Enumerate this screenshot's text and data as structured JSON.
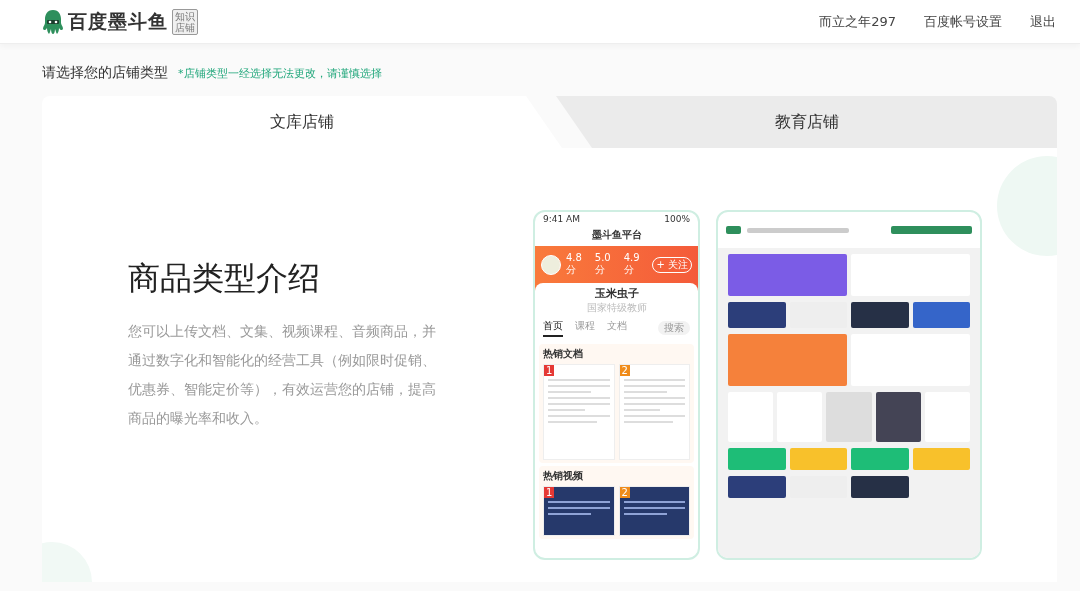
{
  "header": {
    "logo": {
      "name": "百度墨斗鱼",
      "badge": [
        "知识",
        "店铺"
      ]
    },
    "links": [
      "而立之年297",
      "百度帐号设置",
      "退出"
    ]
  },
  "prompt": {
    "title": "请选择您的店铺类型",
    "note": "*店铺类型一经选择无法更改，请谨慎选择"
  },
  "tabs": [
    {
      "label": "文库店铺",
      "selected": true
    },
    {
      "label": "教育店铺",
      "selected": false
    }
  ],
  "intro": {
    "heading": "商品类型介绍",
    "body": "您可以上传文档、文集、视频课程、音频商品，并通过数字化和智能化的经营工具（例如限时促销、优惠券、智能定价等），有效运营您的店铺，提高商品的曝光率和收入。"
  },
  "phone_preview": {
    "status_time": "9:41 AM",
    "battery": "100%",
    "title": "墨斗鱼平台",
    "ratings": [
      "4.8分",
      "5.0分",
      "4.9分"
    ],
    "follow": "+ 关注",
    "name": "玉米虫子",
    "subtitle": "国家特级教师",
    "tabs": [
      {
        "label": "首页",
        "selected": true
      },
      {
        "label": "课程",
        "selected": false
      },
      {
        "label": "文档",
        "selected": false
      }
    ],
    "search": "搜索",
    "sections": [
      {
        "title": "热销文档",
        "kind": "document",
        "items": [
          "1",
          "2"
        ]
      },
      {
        "title": "热销视频",
        "kind": "video",
        "items": [
          "1",
          "2"
        ]
      }
    ]
  }
}
